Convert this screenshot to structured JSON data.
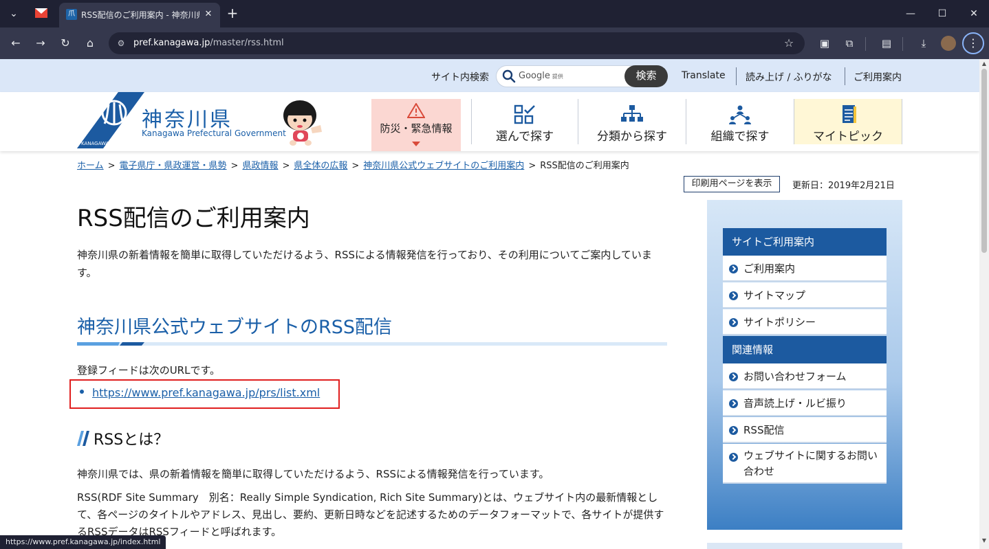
{
  "browser": {
    "tab_title": "RSS配信のご利用案内 - 神奈川県",
    "url_host": "pref.kanagawa.jp",
    "url_path": "/master/rss.html",
    "status_url": "https://www.pref.kanagawa.jp/index.html"
  },
  "util": {
    "search_label": "サイト内検索",
    "google_word": "Google",
    "google_sub": "提供",
    "search_button": "検索",
    "translate": "Translate",
    "furigana": "読み上げ / ふりがな",
    "guide": "ご利用案内"
  },
  "header": {
    "logo_jp": "神奈川県",
    "logo_en": "Kanagawa Prefectural Government",
    "logo_badge": "KANAGAWA",
    "nav": {
      "disaster": "防災・緊急情報",
      "choose": "選んで探す",
      "category": "分類から探す",
      "org": "組織で探す",
      "mytopic": "マイトピック"
    }
  },
  "breadcrumb": {
    "items": [
      "ホーム",
      "電子県庁・県政運営・県勢",
      "県政情報",
      "県全体の広報",
      "神奈川県公式ウェブサイトのご利用案内"
    ],
    "current": "RSS配信のご利用案内",
    "sep": ">"
  },
  "meta": {
    "print": "印刷用ページを表示",
    "updated": "更新日：2019年2月21日"
  },
  "main": {
    "title": "RSS配信のご利用案内",
    "intro": "神奈川県の新着情報を簡単に取得していただけるよう、RSSによる情報発信を行っており、その利用についてご案内しています。",
    "section_title": "神奈川県公式ウェブサイトのRSS配信",
    "feed_label": "登録フィードは次のURLです。",
    "feed_url": "https://www.pref.kanagawa.jp/prs/list.xml",
    "sub_title": "RSSとは？",
    "para1": "神奈川県では、県の新着情報を簡単に取得していただけるよう、RSSによる情報発信を行っています。",
    "para2": "RSS(RDF Site Summary　別名：Really Simple Syndication, Rich Site Summary)とは、ウェブサイト内の最新情報として、各ページのタイトルやアドレス、見出し、要約、更新日時などを記述するためのデータフォーマットで、各サイトが提供するRSSデータはRSSフィードと呼ばれます。"
  },
  "sidebar": {
    "head1": "サイトご利用案内",
    "group1": [
      "ご利用案内",
      "サイトマップ",
      "サイトポリシー"
    ],
    "head2": "関連情報",
    "group2": [
      "お問い合わせフォーム",
      "音声読上げ・ルビ振り",
      "RSS配信",
      "ウェブサイトに関するお問い合わせ"
    ]
  },
  "colors": {
    "brand_blue": "#1a5fa8",
    "sidebar_head": "#1c5aa0",
    "highlight_red": "#e01e1e",
    "util_bar": "#dbe7f8"
  }
}
